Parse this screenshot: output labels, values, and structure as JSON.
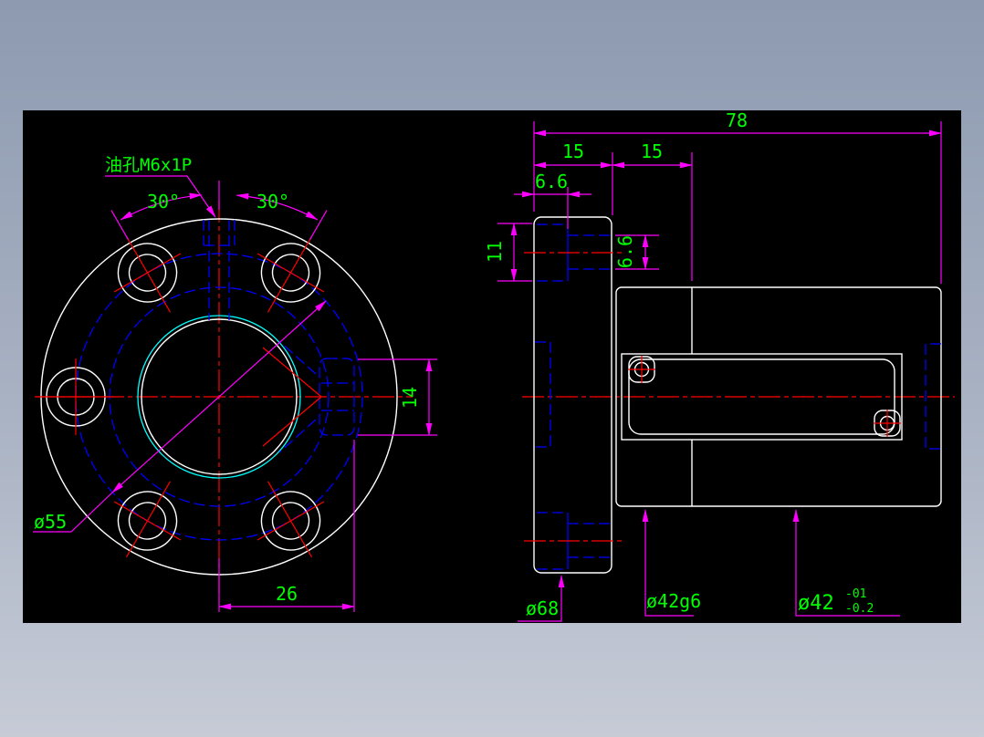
{
  "window": {
    "background_top": "#8d9ab0",
    "background_bottom": "#c6cbd6",
    "canvas_color": "#000000"
  },
  "colors": {
    "geometry": "#ffffff",
    "hidden_line": "#0000ff",
    "centerline": "#ff0000",
    "dimension": "#ff00ff",
    "dim_text": "#00ff00",
    "thread_arc": "#00ffff"
  },
  "front_view": {
    "oil_hole_label": "油孔M6x1P",
    "angle_left": "30°",
    "angle_right": "30°",
    "bolt_circle_diameter": "ø55",
    "flat_offset": "26",
    "keyway_width": "14"
  },
  "side_view": {
    "total_length": "78",
    "flange_thickness": "15",
    "journal_length": "15",
    "oil_counterbore_depth": "6.6",
    "oil_counterbore_width": "11",
    "oil_hole_diameter": "6.6",
    "flange_diameter": "ø68",
    "journal_diameter": "ø42g6",
    "body_diameter": "ø42",
    "body_tolerance_upper": "-01",
    "body_tolerance_lower": "-0.2"
  }
}
